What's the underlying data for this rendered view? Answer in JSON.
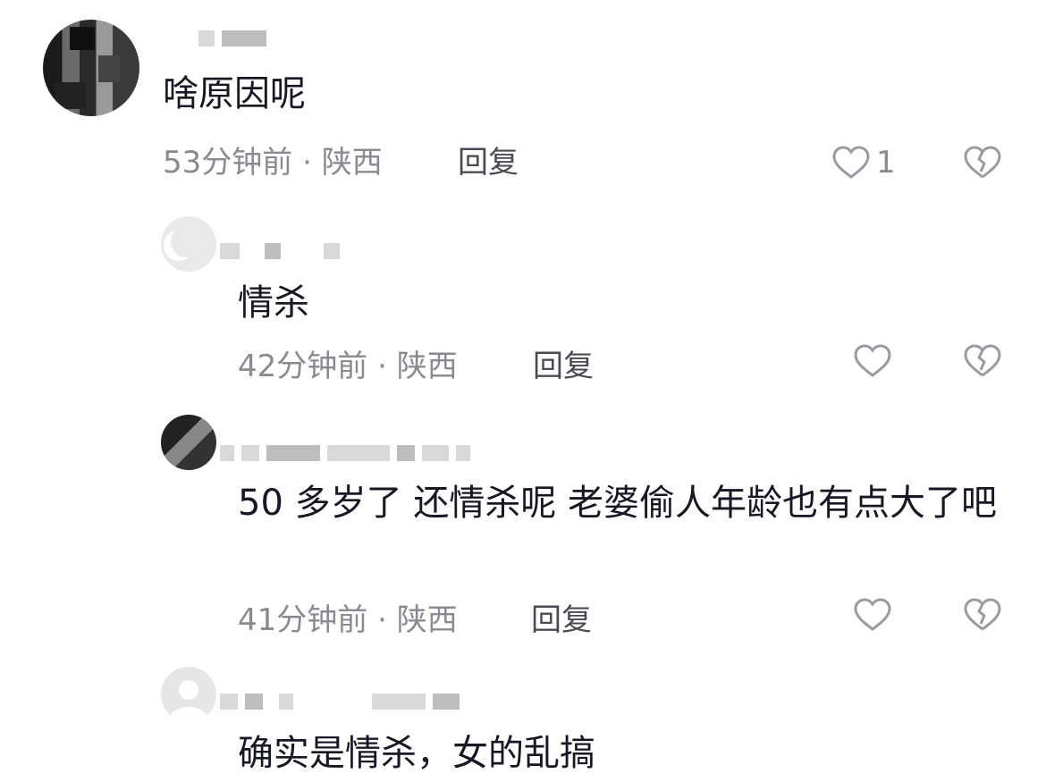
{
  "comments": [
    {
      "text": "啥原因呢",
      "time": "53分钟前",
      "separator": "·",
      "location": "陕西",
      "reply_label": "回复",
      "like_count": "1"
    },
    {
      "text": "情杀",
      "time": "42分钟前",
      "separator": "·",
      "location": "陕西",
      "reply_label": "回复",
      "like_count": ""
    },
    {
      "text": "50 多岁了 还情杀呢 老婆偷人年龄也有点大了吧",
      "time": "41分钟前",
      "separator": "·",
      "location": "陕西",
      "reply_label": "回复",
      "like_count": ""
    },
    {
      "text": "确实是情杀，女的乱搞"
    }
  ],
  "icons": {
    "like": "heart-outline-icon",
    "dislike": "broken-heart-outline-icon"
  },
  "colors": {
    "text": "#161823",
    "meta": "#8a8b91",
    "reply": "#4a4b52",
    "icon": "#9a9ba1"
  }
}
